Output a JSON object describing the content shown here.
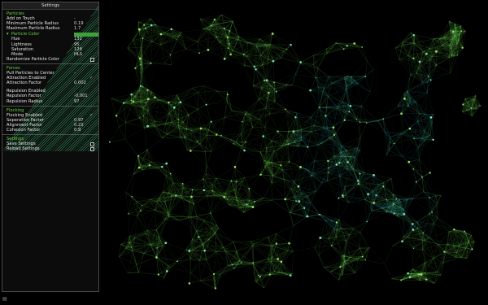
{
  "panel": {
    "title": "Settings",
    "particles": {
      "header": "Particles",
      "add_on_touch": "Add on Touch",
      "add_on_touch_value": "-",
      "min_radius_label": "Minimum Particle Radius",
      "min_radius_value": "0.19",
      "max_radius_label": "Maximum Particle Radius",
      "max_radius_value": "1.7",
      "color_label": "Particle Color",
      "color_value": "#3ea13a",
      "hue_label": "Hue",
      "hue_value": "132",
      "lightness_label": "Lightness",
      "lightness_value": "95",
      "saturation_label": "Saturation",
      "saturation_value": "128",
      "mode_label": "Mode",
      "mode_value": "HLS",
      "randomize_label": "Randomize Particle Color"
    },
    "forces": {
      "header": "Forces",
      "pull_label": "Pull Particles to Center",
      "pull_value": "-",
      "attraction_enabled_label": "Attraction Enabled",
      "attraction_enabled_value": "✓",
      "attraction_factor_label": "Attraction Factor",
      "attraction_factor_value": "0.002",
      "repulsion_enabled_label": "Repulsion Enabled",
      "repulsion_factor_label": "Repulsion Factor",
      "repulsion_factor_value": "-0.001",
      "repulsion_radius_label": "Repulsion Radius",
      "repulsion_radius_value": "97"
    },
    "flocking": {
      "header": "Flocking",
      "enabled_label": "Flocking Enabled",
      "enabled_value": "✓",
      "separation_label": "Seperation Factor",
      "separation_value": "0.97",
      "alignment_label": "Alignment Factor",
      "alignment_value": "0.23",
      "cohesion_label": "Cohesion Factor",
      "cohesion_value": "0.9"
    },
    "settings": {
      "header": "Settings",
      "save_label": "Save Settings",
      "reload_label": "Reload Settings"
    }
  },
  "corner_icon": "grip-icon",
  "colors": {
    "background": "#000000",
    "accent": "#66d240",
    "edge_green": "#5fbf45",
    "edge_cyan": "#2ea7b5"
  }
}
